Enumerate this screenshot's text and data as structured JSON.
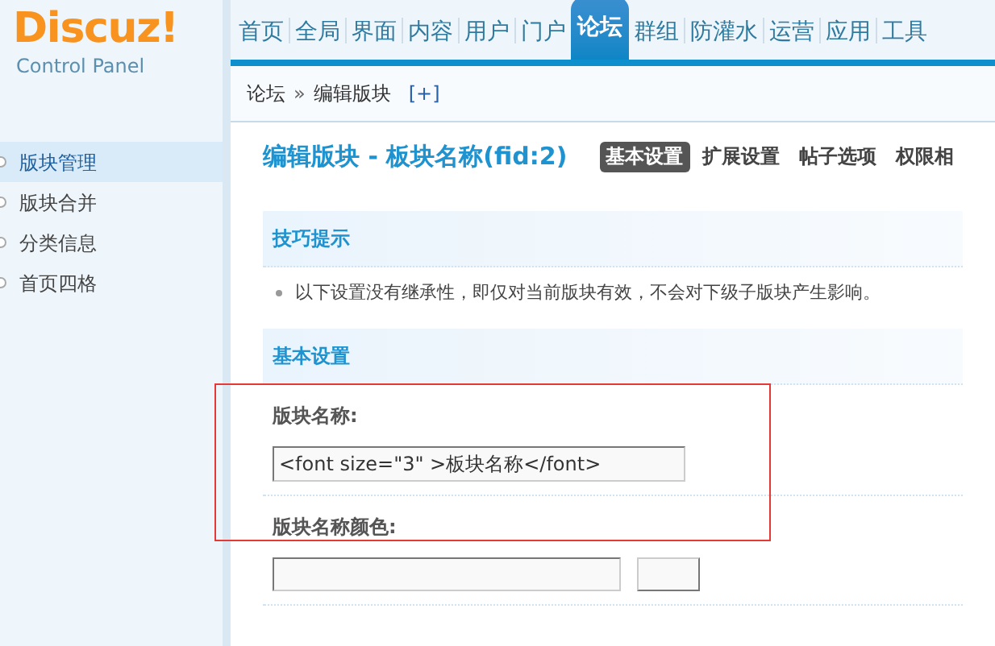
{
  "logo": {
    "brand": "Discuz!",
    "subtitle": "Control Panel"
  },
  "nav": [
    {
      "label": "首页",
      "selected": false
    },
    {
      "label": "全局",
      "selected": false
    },
    {
      "label": "界面",
      "selected": false
    },
    {
      "label": "内容",
      "selected": false
    },
    {
      "label": "用户",
      "selected": false
    },
    {
      "label": "门户",
      "selected": false
    },
    {
      "label": "论坛",
      "selected": true
    },
    {
      "label": "群组",
      "selected": false
    },
    {
      "label": "防灌水",
      "selected": false
    },
    {
      "label": "运营",
      "selected": false
    },
    {
      "label": "应用",
      "selected": false
    },
    {
      "label": "工具",
      "selected": false
    }
  ],
  "breadcrumb": {
    "items": [
      "论坛",
      "编辑版块"
    ],
    "separator": "»",
    "add": "[+]"
  },
  "sidebar": {
    "items": [
      {
        "label": "版块管理",
        "selected": true
      },
      {
        "label": "版块合并",
        "selected": false
      },
      {
        "label": "分类信息",
        "selected": false
      },
      {
        "label": "首页四格",
        "selected": false
      }
    ]
  },
  "page_title": "编辑版块 - 板块名称(fid:2)",
  "tabs": [
    {
      "label": "基本设置",
      "selected": true
    },
    {
      "label": "扩展设置",
      "selected": false
    },
    {
      "label": "帖子选项",
      "selected": false
    },
    {
      "label": "权限相",
      "selected": false
    }
  ],
  "tips": {
    "title": "技巧提示",
    "items": [
      "以下设置没有继承性，即仅对当前版块有效，不会对下级子版块产生影响。"
    ]
  },
  "section": {
    "title": "基本设置",
    "fields": [
      {
        "label": "版块名称:",
        "kind": "text",
        "value": "<font size=\"3\" >板块名称</font>"
      },
      {
        "label": "版块名称颜色:",
        "kind": "color"
      }
    ]
  },
  "highlight": {
    "shown": true
  }
}
